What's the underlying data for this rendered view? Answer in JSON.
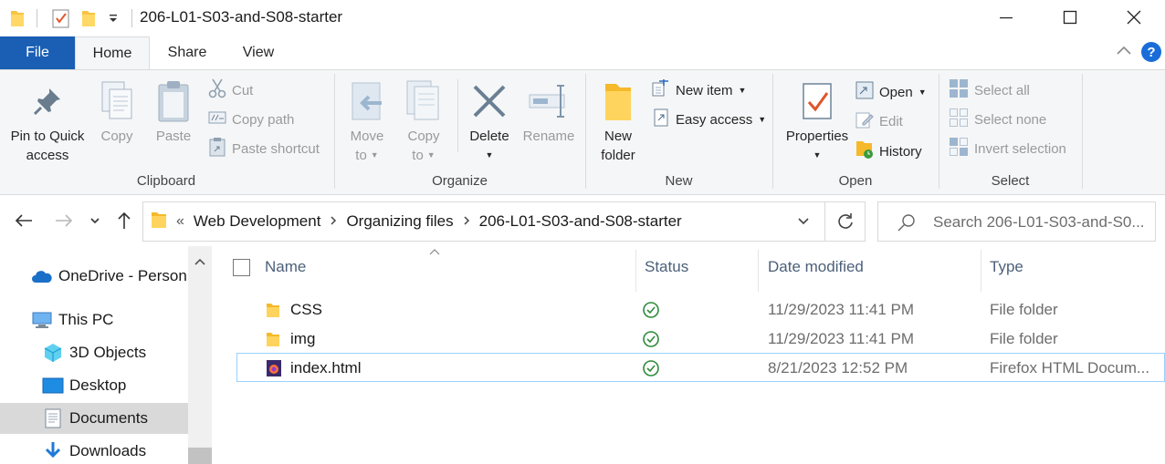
{
  "window": {
    "title": "206-L01-S03-and-S08-starter"
  },
  "ribbon_tabs": {
    "file": "File",
    "home": "Home",
    "share": "Share",
    "view": "View",
    "help": "?"
  },
  "clipboard": {
    "pin_line1": "Pin to Quick",
    "pin_line2": "access",
    "copy": "Copy",
    "paste": "Paste",
    "cut": "Cut",
    "copy_path": "Copy path",
    "paste_shortcut": "Paste shortcut",
    "label": "Clipboard"
  },
  "organize": {
    "move_line1": "Move",
    "move_line2": "to",
    "copy_line1": "Copy",
    "copy_line2": "to",
    "delete": "Delete",
    "rename": "Rename",
    "label": "Organize"
  },
  "new_group": {
    "folder_line1": "New",
    "folder_line2": "folder",
    "new_item": "New item",
    "easy_access": "Easy access",
    "label": "New"
  },
  "open_group": {
    "properties": "Properties",
    "open": "Open",
    "edit": "Edit",
    "history": "History",
    "label": "Open"
  },
  "select_group": {
    "select_all": "Select all",
    "select_none": "Select none",
    "invert": "Invert selection",
    "label": "Select"
  },
  "address": {
    "overflow": "«",
    "crumbs": [
      "Web Development",
      "Organizing files",
      "206-L01-S03-and-S08-starter"
    ],
    "search_placeholder": "Search 206-L01-S03-and-S0..."
  },
  "nav_pane": {
    "items": [
      "OneDrive - Person",
      "This PC",
      "3D Objects",
      "Desktop",
      "Documents",
      "Downloads"
    ],
    "selected": "Documents"
  },
  "file_list": {
    "columns": {
      "name": "Name",
      "status": "Status",
      "date": "Date modified",
      "type": "Type"
    },
    "rows": [
      {
        "name": "CSS",
        "date": "11/29/2023 11:41 PM",
        "type": "File folder",
        "status": "synced"
      },
      {
        "name": "img",
        "date": "11/29/2023 11:41 PM",
        "type": "File folder",
        "status": "synced"
      },
      {
        "name": "index.html",
        "date": "8/21/2023 12:52 PM",
        "type": "Firefox HTML Docum...",
        "status": "synced"
      }
    ]
  },
  "colors": {
    "file_tab": "#1a5fb4",
    "ribbon_bg": "#f5f6f7",
    "folder": "#f8c440",
    "status_ok": "#2e8b3a",
    "selected_nav": "#d9d9d9"
  }
}
